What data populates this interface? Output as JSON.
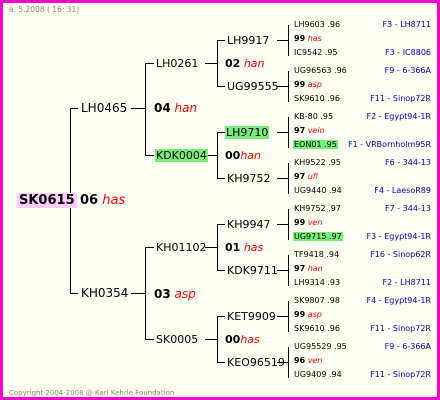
{
  "header": "a. 5.2008 ( 16: 31)",
  "footer": "Copyright 2004-2008 @ Karl Kehrle Foundation",
  "root": {
    "id": "SK0615",
    "gen": "06",
    "race": "has"
  },
  "sire": {
    "id": "LH0465"
  },
  "dam": {
    "id": "KH0354",
    "gen": "03",
    "race": "asp"
  },
  "g3": [
    {
      "id": "LH0261",
      "gen": "04",
      "race": "han"
    },
    {
      "id": "KDK0004",
      "gen": "00",
      "race": "han"
    },
    {
      "id": "KH01102",
      "gen": "01",
      "race": "has"
    },
    {
      "id": "SK0005",
      "gen": "00",
      "race": "has"
    }
  ],
  "g4": [
    {
      "id": "LH9917",
      "gen": "02",
      "race": "han"
    },
    {
      "id": "UG99555"
    },
    {
      "id": "LH9710"
    },
    {
      "id": "KH9752"
    },
    {
      "id": "KH9947"
    },
    {
      "id": "KDK9711"
    },
    {
      "id": "KET9909"
    },
    {
      "id": "KEO96519"
    }
  ],
  "g5": [
    {
      "id": "LH9603 .96",
      "gl": "F3 - LH8711"
    },
    {
      "id": "99",
      "race": "has"
    },
    {
      "id": "IC9542 .95",
      "gl": "F3 - IC8806"
    },
    {
      "id": "UG96563 .96",
      "gl": "F9 - 6-366A"
    },
    {
      "id": "99",
      "race": "asp"
    },
    {
      "id": "SK9610 .96",
      "gl": "F11 - Sinop72R"
    },
    {
      "id": "KB-80 .95",
      "gl": "F2 - Egypt94-1R"
    },
    {
      "id": "97",
      "race": "vein"
    },
    {
      "id": "EON01 .95",
      "gl": "F1 - VRBornholm95R"
    },
    {
      "id": "KH9522 .95",
      "gl": "F6 - 344-13"
    },
    {
      "id": "97",
      "race": "ufi"
    },
    {
      "id": "UG9440 .94",
      "gl": "F4 - LaesoR89"
    },
    {
      "id": "KH9752 .97",
      "gl": "F7 - 344-13"
    },
    {
      "id": "99",
      "race": "ven"
    },
    {
      "id": "UG9715 .97",
      "gl": "F3 - Egypt94-1R"
    },
    {
      "id": "TF9418 .94",
      "gl": "F16 - Sinop62R"
    },
    {
      "id": "97",
      "race": "han"
    },
    {
      "id": "LH9314 .93",
      "gl": "F2 - LH8711"
    },
    {
      "id": "SK9807 .98",
      "gl": "F4 - Egypt94-1R"
    },
    {
      "id": "99",
      "race": "asp"
    },
    {
      "id": "SK9610 .96",
      "gl": "F11 - Sinop72R"
    },
    {
      "id": "UG95529 .95",
      "gl": "F9 - 6-366A"
    },
    {
      "id": "96",
      "race": "ven"
    },
    {
      "id": "UG9409 .94",
      "gl": "F11 - Sinop72R"
    }
  ]
}
